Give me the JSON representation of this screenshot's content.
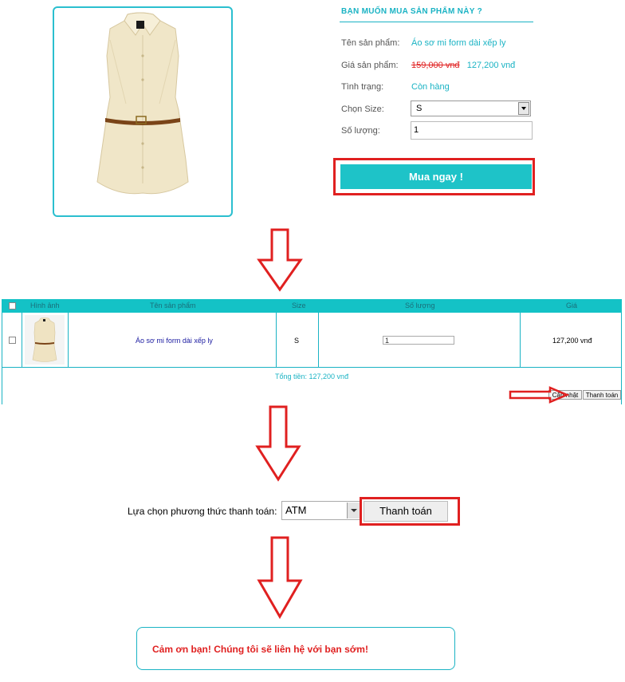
{
  "product": {
    "heading": "BẠN MUỐN MUA SẢN PHẨM NÀY ?",
    "name_label": "Tên sản phẩm:",
    "name_value": "Áo sơ mi form dài xếp ly",
    "price_label": "Giá sản phẩm:",
    "old_price": "159,000 vnđ",
    "new_price": "127,200 vnđ",
    "status_label": "Tình trạng:",
    "status_value": "Còn hàng",
    "size_label": "Chọn Size:",
    "size_value": "S",
    "qty_label": "Số lượng:",
    "qty_value": "1",
    "buy_button": "Mua ngay !"
  },
  "cart": {
    "headers": [
      "Hình ảnh",
      "Tên sản phẩm",
      "Size",
      "Số lượng",
      "Giá"
    ],
    "row": {
      "name": "Áo sơ mi form dài xếp ly",
      "size": "S",
      "qty": "1",
      "price": "127,200 vnđ"
    },
    "total": "Tổng tiền: 127,200 vnđ",
    "update_button": "Cập nhật",
    "checkout_button": "Thanh toán"
  },
  "payment": {
    "label": "Lựa chọn phương thức thanh toán:",
    "method": "ATM",
    "button": "Thanh toán"
  },
  "thanks": {
    "message": "Cảm ơn bạn! Chúng tôi sẽ liên hệ với bạn sớm!"
  },
  "colors": {
    "accent": "#1ab3c4",
    "highlight": "#e02020",
    "button": "#1ec3c8"
  }
}
